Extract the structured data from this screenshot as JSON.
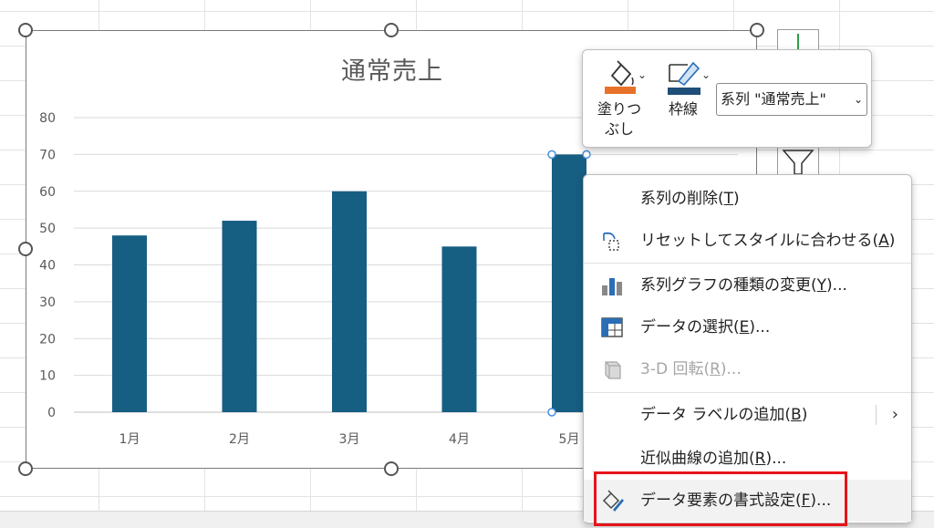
{
  "chart_data": {
    "type": "bar",
    "title": "通常売上",
    "categories": [
      "1月",
      "2月",
      "3月",
      "4月",
      "5月"
    ],
    "series": [
      {
        "values": [
          48,
          52,
          60,
          45,
          70
        ]
      }
    ],
    "ylim": [
      0,
      80
    ],
    "yticks": [
      "0",
      "10",
      "20",
      "30",
      "40",
      "50",
      "60",
      "70",
      "80"
    ],
    "grid": true,
    "color": "#175e83"
  },
  "toolbar": {
    "fill_label_line1": "塗りつ",
    "fill_label_line2": "ぶし",
    "outline_label": "枠線",
    "series_select_value": "系列 \"通常売上\"",
    "fill_color": "#e8722a",
    "outline_color": "#1f4e79"
  },
  "context_menu": {
    "items": [
      {
        "label": "系列の削除(",
        "key": "T",
        "suffix": ")",
        "icon": ""
      },
      {
        "label": "リセットしてスタイルに合わせる(",
        "key": "A",
        "suffix": ")",
        "icon": "reset-style-icon"
      },
      {
        "label": "系列グラフの種類の変更(",
        "key": "Y",
        "suffix": ")...",
        "icon": "change-chart-type-icon"
      },
      {
        "label": "データの選択(",
        "key": "E",
        "suffix": ")...",
        "icon": "select-data-icon"
      },
      {
        "label": "3-D 回転(",
        "key": "R",
        "suffix": ")...",
        "icon": "rotation-3d-icon",
        "disabled": true
      },
      {
        "label": "データ ラベルの追加(",
        "key": "B",
        "suffix": ")",
        "icon": "",
        "submenu": true
      },
      {
        "label": "近似曲線の追加(",
        "key": "R",
        "suffix": ")...",
        "icon": ""
      },
      {
        "label": "データ要素の書式設定(",
        "key": "F",
        "suffix": ")...",
        "icon": "format-data-point-icon",
        "highlighted": true
      }
    ]
  },
  "colors": {
    "highlight_box": "#e8141b",
    "bar": "#175e83"
  }
}
